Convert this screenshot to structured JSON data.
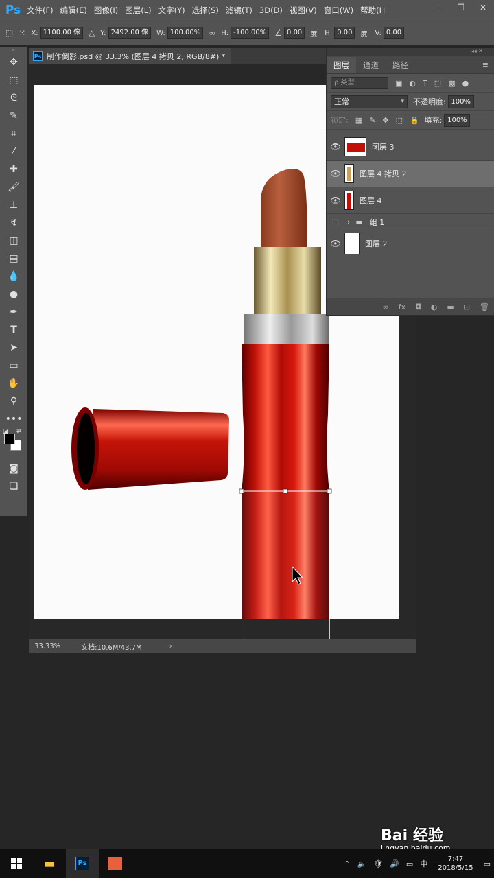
{
  "menubar": {
    "app_logo": "Ps",
    "items": [
      "文件(F)",
      "编辑(E)",
      "图像(I)",
      "图层(L)",
      "文字(Y)",
      "选择(S)",
      "滤镜(T)",
      "3D(D)",
      "视图(V)",
      "窗口(W)",
      "帮助(H"
    ]
  },
  "options": {
    "x_label": "X:",
    "x_value": "1100.00 像",
    "y_label": "Y:",
    "y_value": "2492.00 像",
    "w_label": "W:",
    "w_value": "100.00%",
    "h_label": "H:",
    "h_value": "-100.00%",
    "angle_value": "0.00",
    "angle_unit": "度",
    "hskew_label": "H:",
    "hskew_value": "0.00",
    "hskew_unit": "度",
    "vskew_label": "V:",
    "vskew_value": "0.00"
  },
  "document": {
    "tab_title": "制作倒影.psd @ 33.3% (图层 4 拷贝 2, RGB/8#) *",
    "zoom": "33.33%",
    "doc_info": "文档:10.6M/43.7M"
  },
  "layers_panel": {
    "tabs": [
      "图层",
      "通道",
      "路径"
    ],
    "filter_placeholder": "ρ 类型",
    "blend_mode": "正常",
    "opacity_label": "不透明度:",
    "opacity_value": "100%",
    "lock_label": "锁定:",
    "fill_label": "填充:",
    "fill_value": "100%",
    "layers": [
      {
        "name": "图层 3",
        "visible": true,
        "selected": false
      },
      {
        "name": "图层 4 拷贝 2",
        "visible": true,
        "selected": true
      },
      {
        "name": "图层 4",
        "visible": true,
        "selected": false
      },
      {
        "name": "组 1",
        "visible": false,
        "selected": false
      },
      {
        "name": "图层 2",
        "visible": true,
        "selected": false
      }
    ]
  },
  "taskbar": {
    "ime": "中",
    "time": "7:47",
    "date": "2018/5/15"
  },
  "watermark": {
    "brand": "Bai 经验",
    "url": "jingyan.baidu.com"
  }
}
